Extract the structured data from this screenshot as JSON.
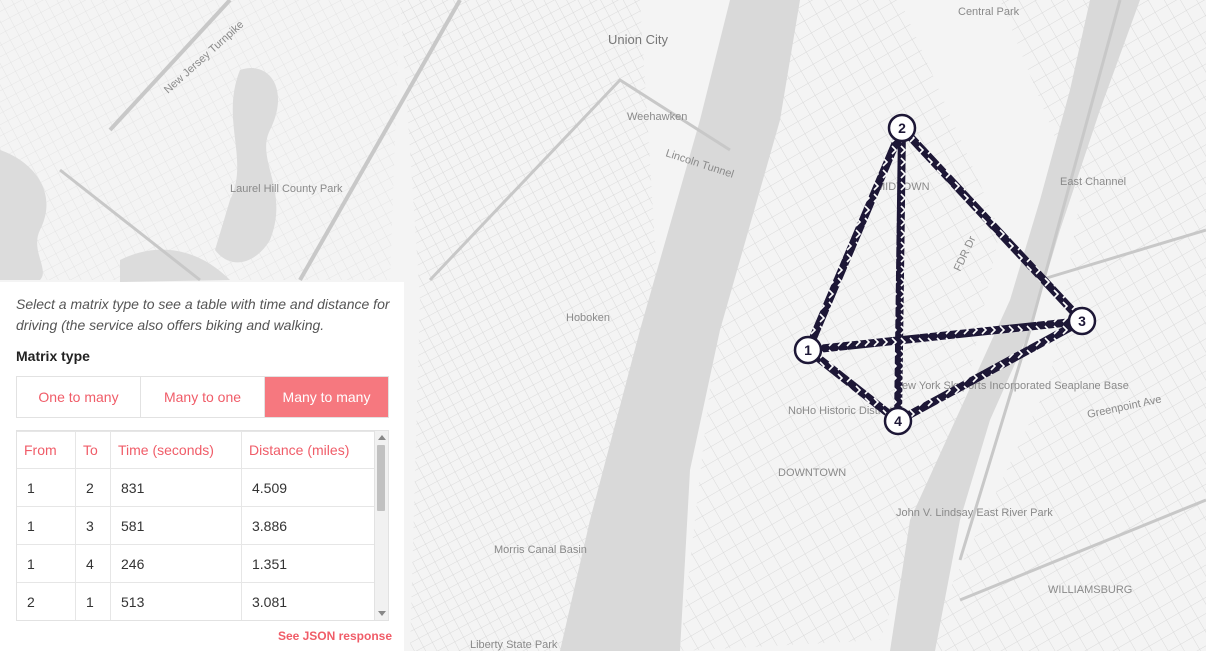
{
  "map": {
    "labels": {
      "union_city": "Union City",
      "weehawken": "Weehawken",
      "hoboken": "Hoboken",
      "lincoln_tunnel": "Lincoln Tunnel",
      "central_park": "Central Park",
      "midtown": "MIDTOWN",
      "downtown": "DOWNTOWN",
      "williamsburg": "WILLIAMSBURG",
      "east_channel": "East Channel",
      "nj_turnpike": "New Jersey Turnpike",
      "laurel_hill": "Laurel Hill County Park",
      "noho": "NoHo Historic District",
      "morris_canal": "Morris Canal Basin",
      "skyports": "New York Skyports Incorporated Seaplane Base",
      "lindsay_park": "John V. Lindsay East River Park",
      "greenpoint": "Greenpoint Ave",
      "fdr": "FDR Dr",
      "liberty_state_park": "Liberty State Park"
    },
    "markers": [
      {
        "id": "1"
      },
      {
        "id": "2"
      },
      {
        "id": "3"
      },
      {
        "id": "4"
      }
    ]
  },
  "panel": {
    "intro": "Select a matrix type to see a table with time and distance for driving (the service also offers biking and walking.",
    "matrix_type_label": "Matrix type",
    "tabs": [
      "One to many",
      "Many to one",
      "Many to many"
    ],
    "active_tab": "Many to many",
    "table": {
      "headers": [
        "From",
        "To",
        "Time (seconds)",
        "Distance (miles)"
      ],
      "rows": [
        [
          "1",
          "2",
          "831",
          "4.509"
        ],
        [
          "1",
          "3",
          "581",
          "3.886"
        ],
        [
          "1",
          "4",
          "246",
          "1.351"
        ],
        [
          "2",
          "1",
          "513",
          "3.081"
        ]
      ]
    },
    "json_link": "See JSON response"
  },
  "colors": {
    "accent": "#f05c68",
    "active_tab_bg": "#f6787f",
    "route": "#1d1736"
  }
}
